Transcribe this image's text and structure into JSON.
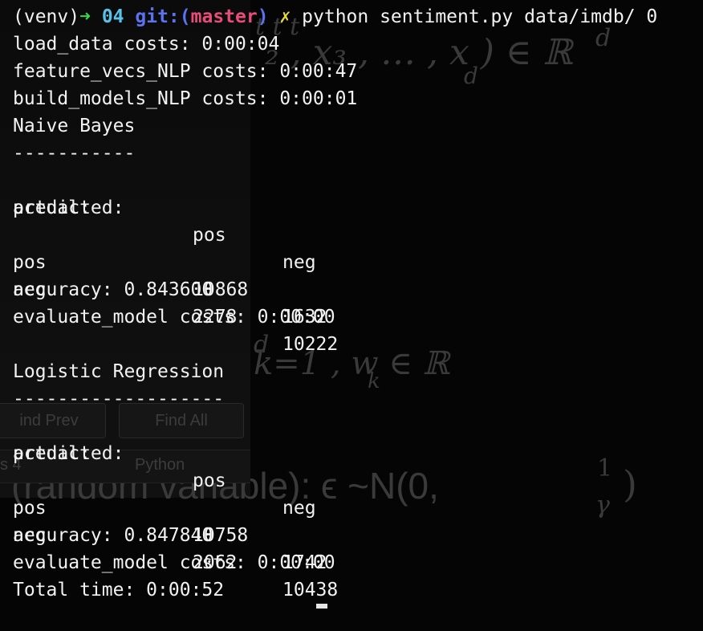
{
  "background": {
    "math_line1": "t      t         t",
    "math_line1b": "₂ , x₃ , … , x  ) ∈ ℝ",
    "math_sub_d": "d",
    "math_sup_d": "d",
    "math_line2_sup": "d",
    "math_line2": "k=1 , w   ∈ ℝ",
    "math_line2_sub": "k",
    "math_line3": "(random variable): ϵ ~N(0,",
    "math_frac_num": "1",
    "math_frac_den": "γ",
    "math_close": ")",
    "find_prev_label": "ind Prev",
    "find_all_label": "Find All",
    "status_left": "s 4",
    "status_python": "Python"
  },
  "prompt": {
    "venv": "(venv)",
    "arrow": "➜",
    "dir": "04",
    "git": "git:",
    "paren_open": "(",
    "branch": "master",
    "paren_close": ")",
    "dirty": "✗",
    "command": "python sentiment.py data/imdb/ 0"
  },
  "output": {
    "load_data": "load_data costs: 0:00:04",
    "feature_vecs": "feature_vecs_NLP costs: 0:00:47",
    "build_models": "build_models_NLP costs: 0:00:01",
    "models": [
      {
        "name": "Naive Bayes",
        "rule": "-----------",
        "predicted_label": "predicted:",
        "col_pos": "pos",
        "col_neg": "neg",
        "actual_label": "actual:",
        "rows": [
          {
            "label": "pos",
            "pos": "10868",
            "neg": "1632"
          },
          {
            "label": "neg",
            "pos": "2278",
            "neg": "10222"
          }
        ],
        "accuracy": "accuracy: 0.843600",
        "evaluate": "evaluate_model costs: 0:00:00"
      },
      {
        "name": "Logistic Regression",
        "rule": "-------------------",
        "predicted_label": "predicted:",
        "col_pos": "pos",
        "col_neg": "neg",
        "actual_label": "actual:",
        "rows": [
          {
            "label": "pos",
            "pos": "10758",
            "neg": "1742"
          },
          {
            "label": "neg",
            "pos": "2062",
            "neg": "10438"
          }
        ],
        "accuracy": "accuracy: 0.847840",
        "evaluate": "evaluate_model costs: 0:00:00"
      }
    ],
    "total_time": "Total time: 0:00:52"
  },
  "colors": {
    "background": "#050505",
    "text": "#f2f2f2",
    "arrow": "#38d64a",
    "dir": "#57c3e9",
    "git": "#5b73f0",
    "branch": "#e84d7a",
    "dirty": "#e8d83a"
  }
}
